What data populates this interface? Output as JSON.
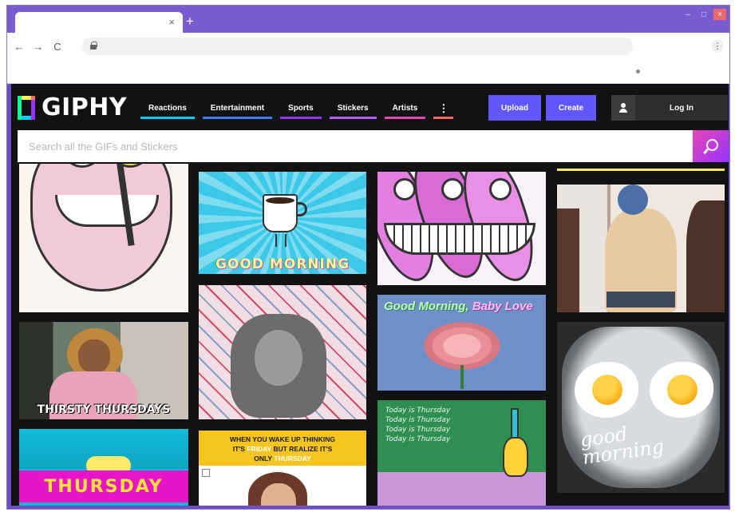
{
  "browser": {
    "tab_close": "×",
    "new_tab": "+",
    "window_controls": {
      "minimize": "–",
      "maximize": "□",
      "close": "×"
    },
    "nav": {
      "back": "←",
      "forward": "→",
      "reload": "C"
    },
    "menu": "⋮"
  },
  "giphy": {
    "logo_text": "GIPHY",
    "nav": [
      {
        "label": "Reactions",
        "color": "#00ccff"
      },
      {
        "label": "Entertainment",
        "color": "#3e7cff"
      },
      {
        "label": "Sports",
        "color": "#9933ff"
      },
      {
        "label": "Stickers",
        "color": "#b45cff"
      },
      {
        "label": "Artists",
        "color": "#e646b6"
      }
    ],
    "nav_more": "⋮",
    "upload_label": "Upload",
    "create_label": "Create",
    "login_label": "Log In",
    "search_placeholder": "Search all the GIFs and Stickers",
    "accent_color": "#6157ff"
  },
  "gifs": {
    "thirsty_caption": "THIRSTY THURSDAYS",
    "good_morning_cup_caption": "GOOD MORNING",
    "rose_title_1": "Good Morning,",
    "rose_title_2": "Baby Love",
    "chalkboard_lines": [
      "Today is Thursday",
      "Today is Thursday",
      "Today is Thursday",
      "Today is Thursday"
    ],
    "eggs_script_1": "good",
    "eggs_script_2": "morning",
    "thursday_caption": "THURSDAY",
    "wake_up_text_1": "WHEN YOU WAKE UP THINKING",
    "wake_up_text_2a": "IT'S",
    "wake_up_text_2b": "FRIDAY",
    "wake_up_text_2c": "BUT REALIZE IT'S",
    "wake_up_text_3a": "ONLY",
    "wake_up_text_3b": "THURSDAY"
  }
}
